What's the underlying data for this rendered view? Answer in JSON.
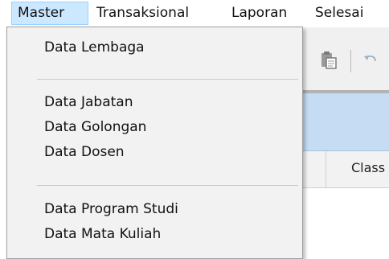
{
  "menubar": {
    "items": [
      {
        "label": "Master",
        "active": true
      },
      {
        "label": "Transaksional"
      },
      {
        "label": "Laporan"
      },
      {
        "label": "Selesai"
      }
    ]
  },
  "dropdown": {
    "groups": [
      [
        "Data Lembaga"
      ],
      [
        "Data Jabatan",
        "Data Golongan",
        "Data Dosen"
      ],
      [
        "Data Program Studi",
        "Data Mata Kuliah"
      ]
    ]
  },
  "toolbar": {
    "icons": [
      "paste-icon",
      "undo-icon"
    ]
  },
  "grid": {
    "column_header_partial": "Class"
  },
  "colors": {
    "menu_active_bg": "#cce8ff",
    "menu_active_border": "#99d1ff",
    "dropdown_bg": "#f2f2f2",
    "title_bar": "#c6dcf3"
  }
}
